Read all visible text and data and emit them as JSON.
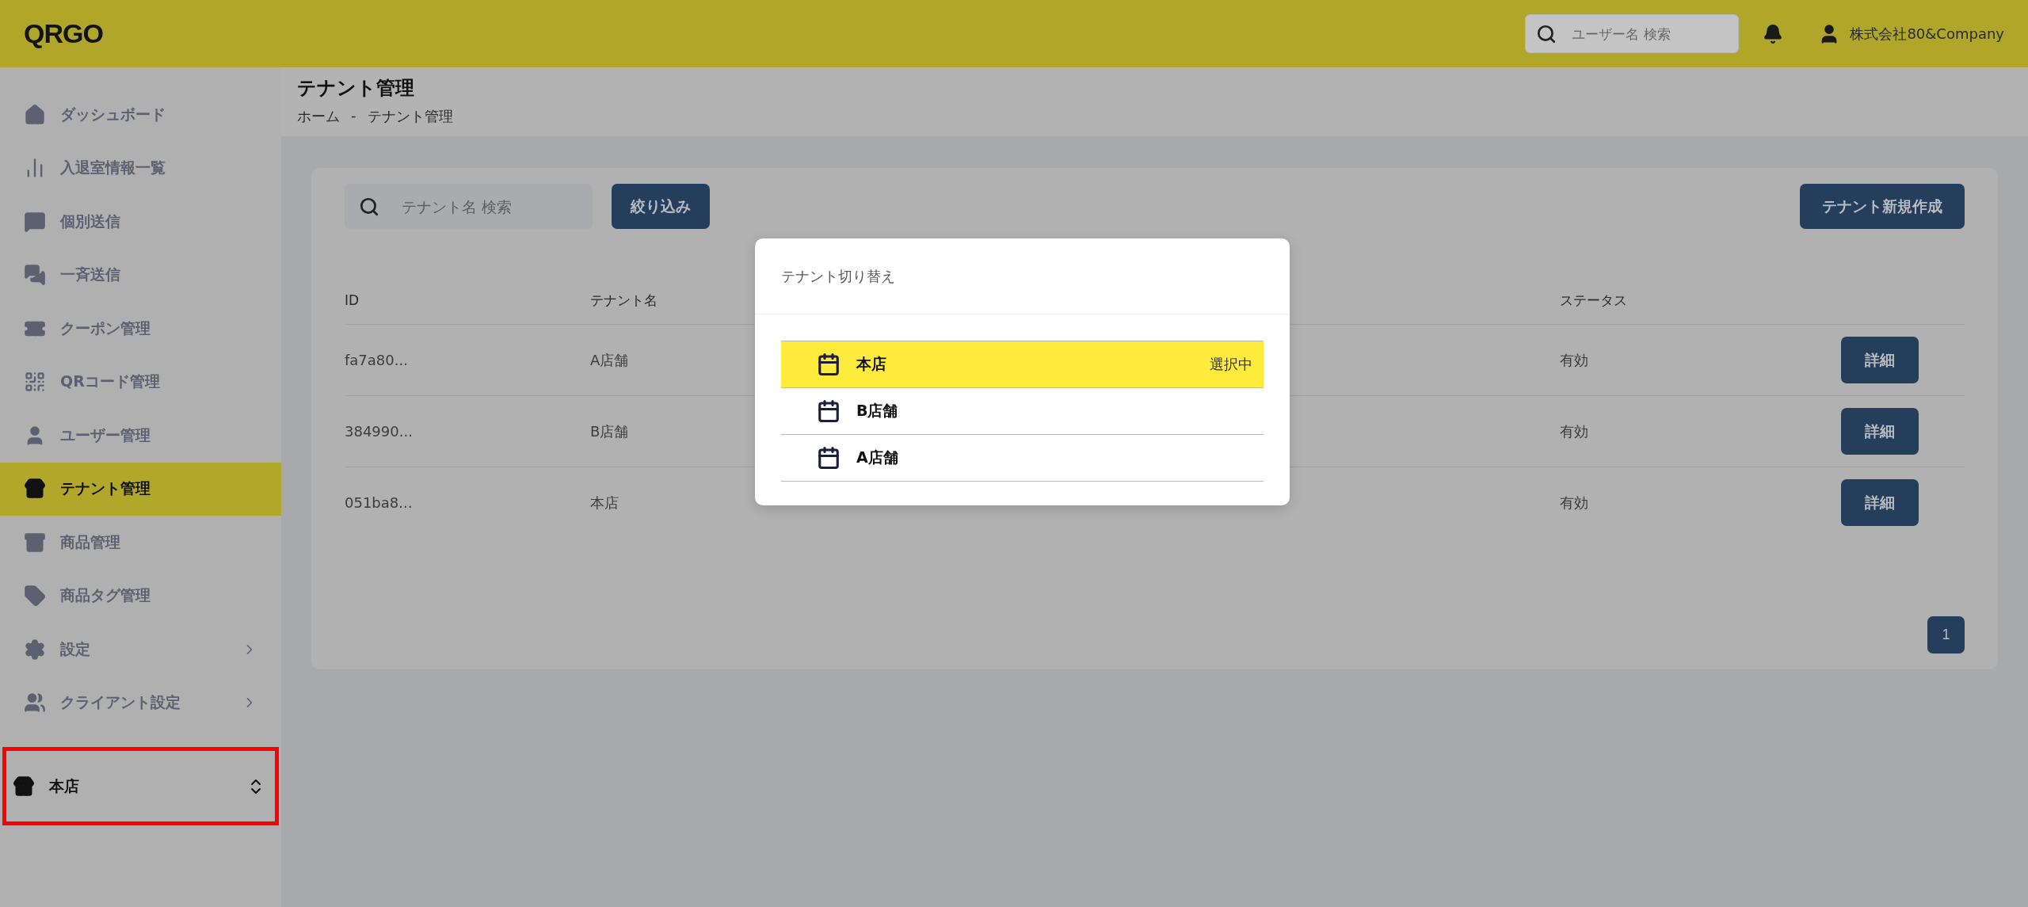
{
  "header": {
    "logo": "QRGO",
    "search": {
      "placeholder": "ユーザー名 検索"
    },
    "account": "株式会社80&Company"
  },
  "sidebar": {
    "items": [
      {
        "label": "ダッシュボード",
        "selected": false,
        "kind": "link"
      },
      {
        "label": "入退室情報一覧",
        "selected": false,
        "kind": "link"
      },
      {
        "label": "個別送信",
        "selected": false,
        "kind": "link"
      },
      {
        "label": "一斉送信",
        "selected": false,
        "kind": "link"
      },
      {
        "label": "クーポン管理",
        "selected": false,
        "kind": "link"
      },
      {
        "label": "QRコード管理",
        "selected": false,
        "kind": "link"
      },
      {
        "label": "ユーザー管理",
        "selected": false,
        "kind": "link"
      },
      {
        "label": "テナント管理",
        "selected": true,
        "kind": "link"
      },
      {
        "label": "商品管理",
        "selected": false,
        "kind": "link"
      },
      {
        "label": "商品タグ管理",
        "selected": false,
        "kind": "link"
      },
      {
        "label": "設定",
        "selected": false,
        "kind": "group"
      },
      {
        "label": "クライアント設定",
        "selected": false,
        "kind": "group"
      }
    ],
    "tenant_switcher": {
      "label": "本店"
    }
  },
  "page": {
    "title": "テナント管理",
    "breadcrumb": [
      "ホーム",
      "-",
      "テナント管理"
    ]
  },
  "toolbar": {
    "search": {
      "placeholder": "テナント名 検索"
    },
    "filter_button": "絞り込み",
    "create_button": "テナント新規作成"
  },
  "table": {
    "columns": [
      "ID",
      "テナント名",
      "ステータス"
    ],
    "rows": [
      {
        "id": "fa7a80...",
        "name": "A店舗",
        "status": "有効",
        "action": "詳細"
      },
      {
        "id": "384990...",
        "name": "B店舗",
        "status": "有効",
        "action": "詳細"
      },
      {
        "id": "051ba8...",
        "name": "本店",
        "status": "有効",
        "action": "詳細"
      }
    ]
  },
  "pagination": [
    {
      "label": "1",
      "selected": true
    }
  ],
  "dialog": {
    "title": "テナント切り替え",
    "items": [
      {
        "label": "本店",
        "selected": true,
        "badge": "選択中"
      },
      {
        "label": "B店舗",
        "selected": false
      },
      {
        "label": "A店舗",
        "selected": false
      }
    ]
  }
}
